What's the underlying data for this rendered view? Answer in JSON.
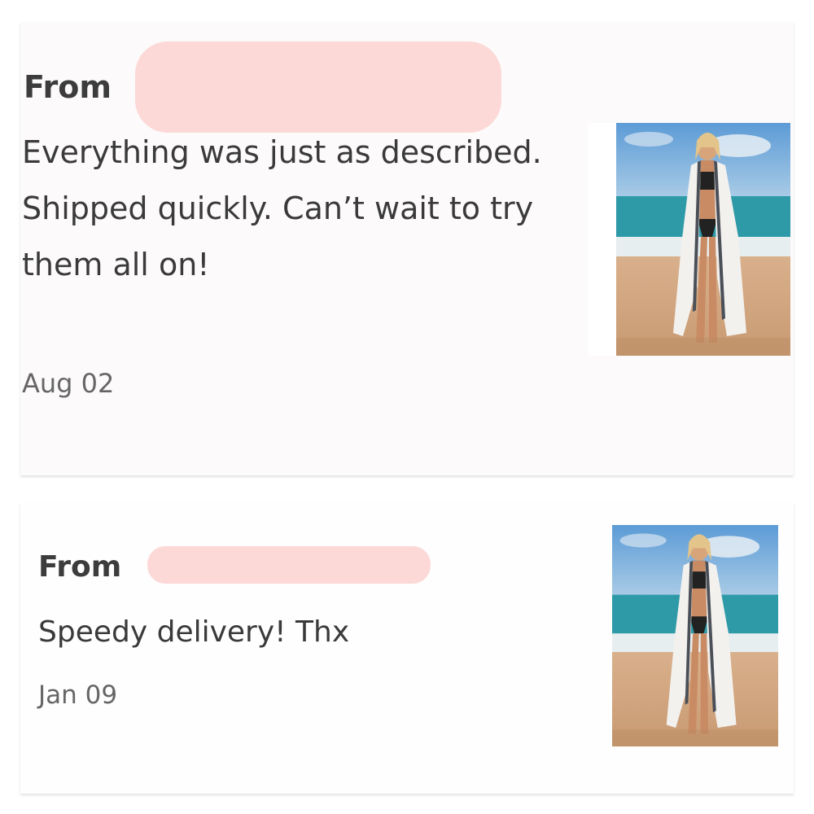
{
  "reviews": [
    {
      "from_label": "From",
      "text": "Everything was just as described. Shipped quickly. Can’t wait to try them all on!",
      "date": "Aug 02",
      "product_image": "beach-cover-up-photo"
    },
    {
      "from_label": "From",
      "text": "Speedy delivery! Thx",
      "date": "Jan 09",
      "product_image": "beach-cover-up-photo"
    }
  ],
  "colors": {
    "redaction": "#fcd9d7",
    "card_bg": "#fcfafa",
    "text": "#3a3a3a",
    "date_text": "#666666"
  }
}
